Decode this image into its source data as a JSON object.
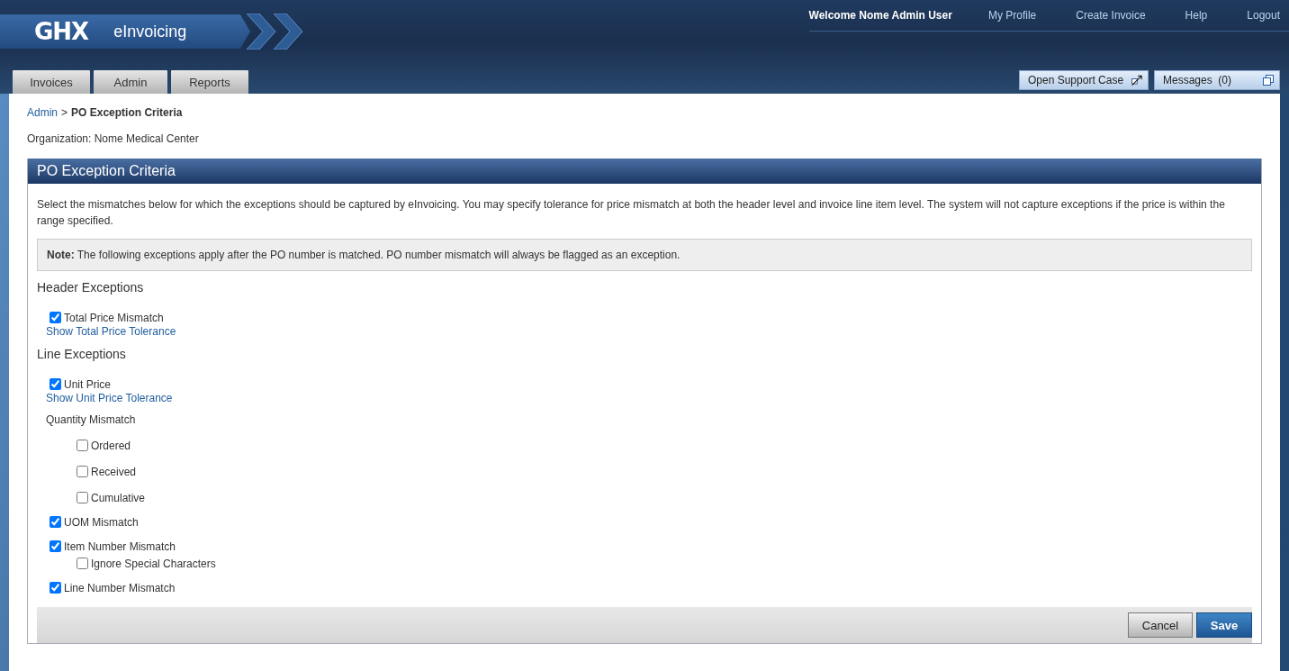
{
  "header": {
    "logo": "GHX",
    "app_name": "eInvoicing",
    "welcome": "Welcome Nome Admin User",
    "links": [
      "My Profile",
      "Create Invoice",
      "Help",
      "Logout"
    ]
  },
  "tabs": [
    {
      "label": "Invoices",
      "selected": false
    },
    {
      "label": "Admin",
      "selected": false
    },
    {
      "label": "Reports",
      "selected": false
    }
  ],
  "utility_buttons": [
    {
      "label": "Open Support Case",
      "kind": "external"
    },
    {
      "label": "Messages  (0)",
      "kind": "popup"
    }
  ],
  "breadcrumb": {
    "link": "Admin",
    "separator": ">",
    "current": "PO Exception Criteria"
  },
  "organization": "Organization: Nome Medical Center",
  "panel": {
    "title": "PO Exception Criteria",
    "intro": "Select the mismatches below for which the exceptions should be captured by eInvoicing. You may specify tolerance for price mismatch at both the header level and invoice line item level. The system will not capture exceptions if the price is within the range specified.",
    "note": "**Note:** The following exceptions apply after the PO number is matched. PO number mismatch will always be flagged as an exception.",
    "sections": [
      {
        "heading": "Header Exceptions",
        "items": [
          {
            "kind": "checkbox",
            "label": "Total Price Mismatch",
            "checked": true
          },
          {
            "kind": "link",
            "label": "Show Total Price Tolerance"
          }
        ]
      },
      {
        "heading": "Line Exceptions",
        "items": [
          {
            "kind": "checkbox",
            "label": "Unit Price",
            "checked": true
          },
          {
            "kind": "link",
            "label": "Show Unit Price Tolerance"
          },
          {
            "kind": "label",
            "label": "Quantity Mismatch"
          },
          {
            "kind": "subcheckbox",
            "label": "Ordered",
            "checked": false
          },
          {
            "kind": "subcheckbox",
            "label": "Received",
            "checked": false
          },
          {
            "kind": "subcheckbox",
            "label": "Cumulative",
            "checked": false
          },
          {
            "kind": "checkbox",
            "label": "UOM Mismatch",
            "checked": true
          },
          {
            "kind": "checkbox",
            "label": "Item Number Mismatch",
            "checked": true
          },
          {
            "kind": "option",
            "label": "Ignore Special Characters",
            "checked": false
          },
          {
            "kind": "checkbox",
            "label": "Line Number Mismatch",
            "checked": true
          }
        ]
      }
    ],
    "buttons": [
      {
        "label": "Cancel",
        "kind": "secondary"
      },
      {
        "label": "Save",
        "kind": "primary"
      }
    ]
  }
}
